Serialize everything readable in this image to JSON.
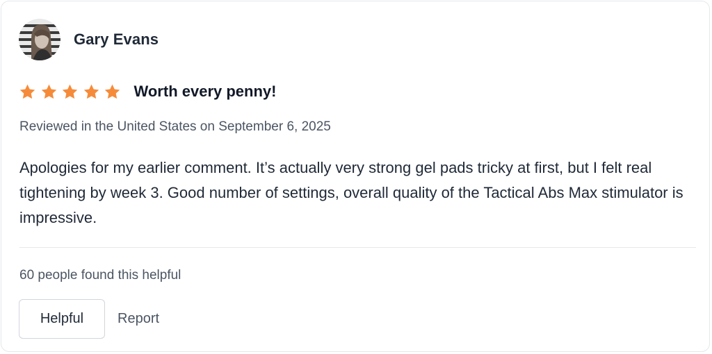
{
  "reviewer": {
    "name": "Gary Evans",
    "avatar_icon": "reviewer-avatar-photo"
  },
  "rating": {
    "stars": 5,
    "max_stars": 5,
    "star_color": "#f58b3a",
    "star_icon": "star-icon"
  },
  "review": {
    "title": "Worth every penny!",
    "meta": "Reviewed in the United States on September 6, 2025",
    "body": "Apologies for my earlier comment. It’s actually very strong gel pads tricky at first, but I felt real tightening by week 3. Good number of settings, overall quality of the Tactical Abs Max stimulator is impressive."
  },
  "footer": {
    "helpful_count_text": "60 people found this helpful",
    "helpful_button_label": "Helpful",
    "report_label": "Report"
  }
}
